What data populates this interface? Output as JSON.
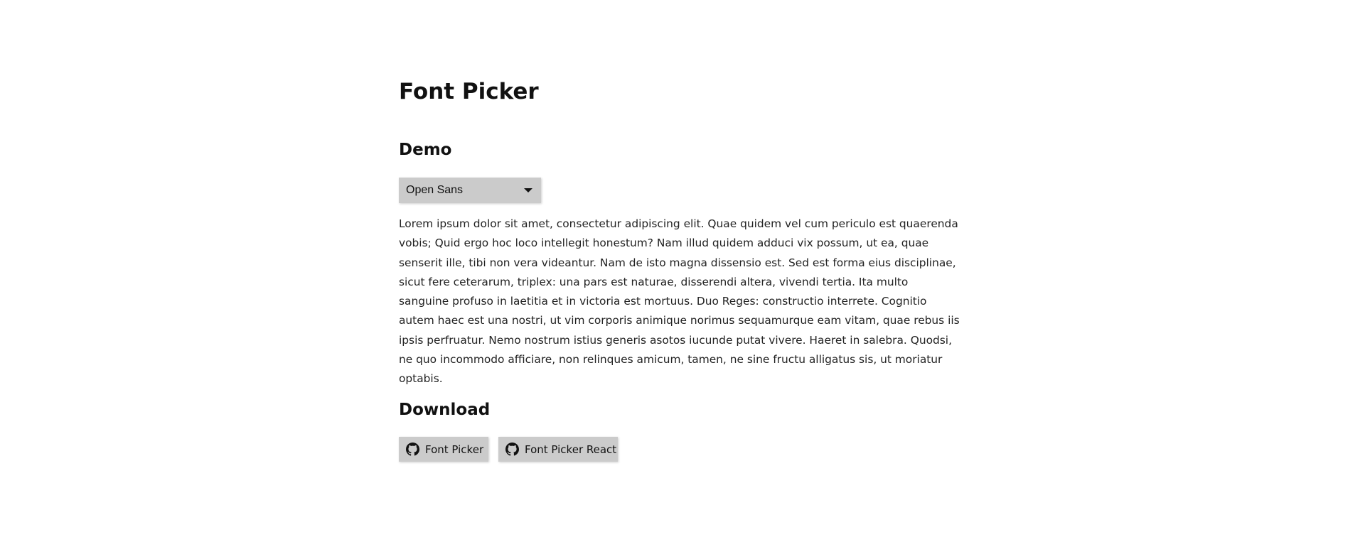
{
  "page": {
    "title": "Font Picker"
  },
  "demo": {
    "heading": "Demo",
    "font_picker": {
      "selected": "Open Sans",
      "icon": "caret-down-icon"
    },
    "sample_text": "Lorem ipsum dolor sit amet, consectetur adipiscing elit. Quae quidem vel cum periculo est quaerenda vobis; Quid ergo hoc loco intellegit honestum? Nam illud quidem adduci vix possum, ut ea, quae senserit ille, tibi non vera videantur. Nam de isto magna dissensio est. Sed est forma eius disciplinae, sicut fere ceterarum, triplex: una pars est naturae, disserendi altera, vivendi tertia. Ita multo sanguine profuso in laetitia et in victoria est mortuus. Duo Reges: constructio interrete. Cognitio autem haec est una nostri, ut vim corporis animique norimus sequamurque eam vitam, quae rebus iis ipsis perfruatur. Nemo nostrum istius generis asotos iucunde putat vivere. Haeret in salebra. Quodsi, ne quo incommodo afficiare, non relinques amicum, tamen, ne sine fructu alligatus sis, ut moriatur optabis."
  },
  "download": {
    "heading": "Download",
    "buttons": [
      {
        "label": "Font Picker",
        "icon": "github-icon"
      },
      {
        "label": "Font Picker React",
        "icon": "github-icon"
      }
    ]
  },
  "colors": {
    "background": "#ffffff",
    "button_background": "#cbcbcb",
    "text": "#111111"
  }
}
